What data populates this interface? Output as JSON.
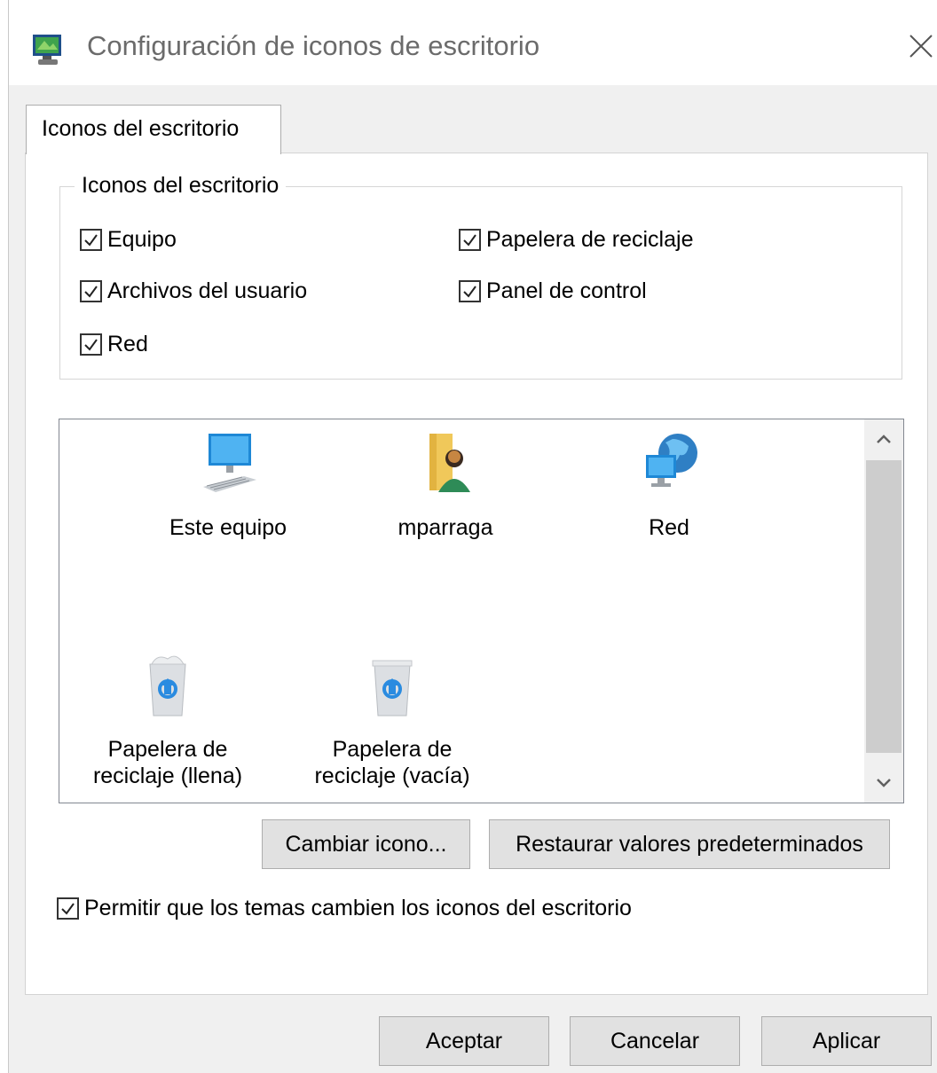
{
  "window": {
    "title": "Configuración de iconos de escritorio",
    "icon": "display-properties-icon",
    "close_icon": "close-icon"
  },
  "tabs": [
    {
      "label": "Iconos del escritorio",
      "selected": true
    }
  ],
  "group": {
    "legend": "Iconos del escritorio",
    "checkboxes": [
      {
        "label": "Equipo",
        "checked": true
      },
      {
        "label": "Papelera de reciclaje",
        "checked": true
      },
      {
        "label": "Archivos del usuario",
        "checked": true
      },
      {
        "label": "Panel de control",
        "checked": true
      },
      {
        "label": "Red",
        "checked": true
      }
    ]
  },
  "icon_list": {
    "items": [
      {
        "label": "Este equipo",
        "icon": "computer-icon"
      },
      {
        "label": "mparraga",
        "icon": "user-folder-icon"
      },
      {
        "label": "Red",
        "icon": "network-icon"
      },
      {
        "label_line1": "Papelera de",
        "label_line2": "reciclaje (llena)",
        "icon": "recycle-bin-full-icon"
      },
      {
        "label_line1": "Papelera de",
        "label_line2": "reciclaje (vacía)",
        "icon": "recycle-bin-empty-icon"
      }
    ]
  },
  "buttons": {
    "change_icon": "Cambiar icono...",
    "restore_defaults": "Restaurar valores predeterminados",
    "ok": "Aceptar",
    "cancel": "Cancelar",
    "apply": "Aplicar"
  },
  "allow_themes": {
    "label": "Permitir que los temas cambien los iconos del escritorio",
    "checked": true
  },
  "colors": {
    "accent": "#0078d7",
    "dialog_bg": "#f0f0f0",
    "button_bg": "#e1e1e1"
  }
}
